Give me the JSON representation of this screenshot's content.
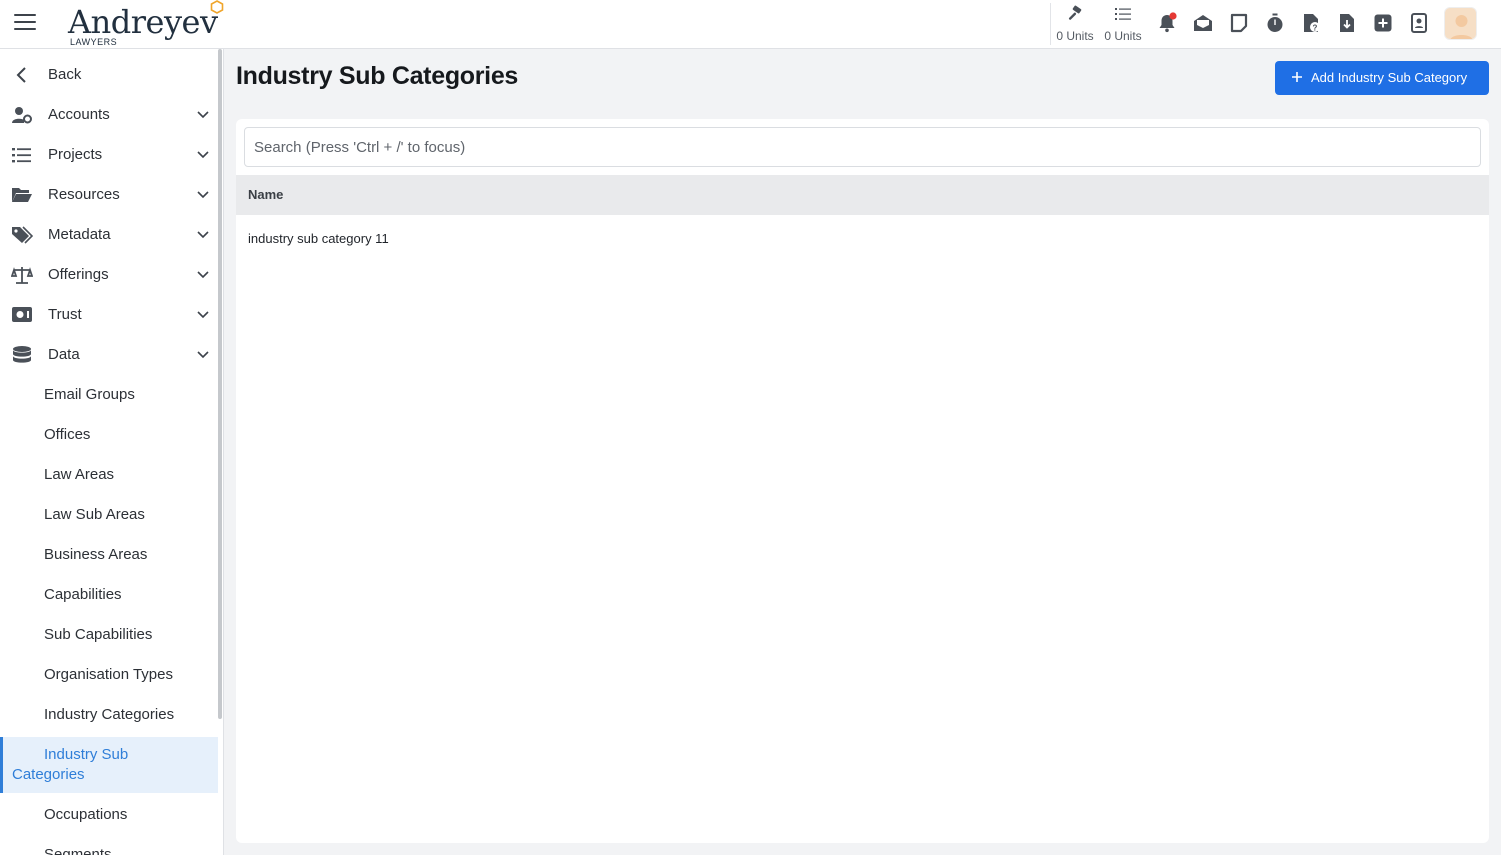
{
  "header": {
    "logo_text": "Andreyev",
    "logo_subtext": "LAWYERS",
    "units": [
      {
        "icon": "gavel-icon",
        "label": "0 Units"
      },
      {
        "icon": "list-icon",
        "label": "0 Units"
      }
    ],
    "toolbar_icons": [
      "bell-icon",
      "mail-icon",
      "note-icon",
      "stopwatch-icon",
      "file-question-icon",
      "file-download-icon",
      "plus-square-icon",
      "contact-card-icon"
    ],
    "notification_dot_color": "#e53935"
  },
  "sidebar": {
    "back_label": "Back",
    "sections": [
      {
        "label": "Accounts",
        "icon": "user-cog-icon"
      },
      {
        "label": "Projects",
        "icon": "list-icon"
      },
      {
        "label": "Resources",
        "icon": "folder-open-icon"
      },
      {
        "label": "Metadata",
        "icon": "tags-icon"
      },
      {
        "label": "Offerings",
        "icon": "scale-icon"
      },
      {
        "label": "Trust",
        "icon": "safe-icon"
      },
      {
        "label": "Data",
        "icon": "database-icon"
      }
    ],
    "data_items": [
      "Email Groups",
      "Offices",
      "Law Areas",
      "Law Sub Areas",
      "Business Areas",
      "Capabilities",
      "Sub Capabilities",
      "Organisation Types",
      "Industry Categories"
    ],
    "active_item": {
      "line1": "Industry Sub",
      "line2": "Categories"
    },
    "after_items": [
      "Occupations",
      "Segments"
    ]
  },
  "main": {
    "title": "Industry Sub Categories",
    "add_button_label": "Add Industry Sub Category",
    "search_placeholder": "Search (Press 'Ctrl + /' to focus)",
    "table": {
      "columns": [
        "Name"
      ],
      "rows": [
        [
          "industry sub category 11"
        ]
      ]
    }
  },
  "colors": {
    "accent": "#1f6fe5",
    "active_bg": "#e6f0fb",
    "active_text": "#2f7ed8"
  }
}
